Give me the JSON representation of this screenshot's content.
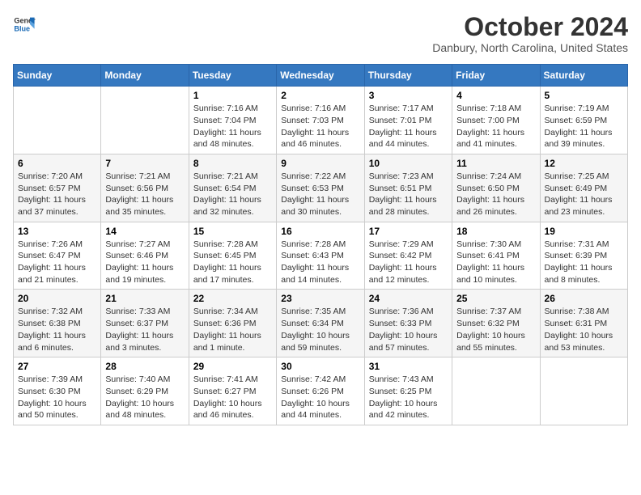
{
  "header": {
    "logo": {
      "text_general": "General",
      "text_blue": "Blue"
    },
    "title": "October 2024",
    "subtitle": "Danbury, North Carolina, United States"
  },
  "calendar": {
    "weekdays": [
      "Sunday",
      "Monday",
      "Tuesday",
      "Wednesday",
      "Thursday",
      "Friday",
      "Saturday"
    ],
    "weeks": [
      [
        {
          "day": "",
          "info": ""
        },
        {
          "day": "",
          "info": ""
        },
        {
          "day": "1",
          "info": "Sunrise: 7:16 AM\nSunset: 7:04 PM\nDaylight: 11 hours and 48 minutes."
        },
        {
          "day": "2",
          "info": "Sunrise: 7:16 AM\nSunset: 7:03 PM\nDaylight: 11 hours and 46 minutes."
        },
        {
          "day": "3",
          "info": "Sunrise: 7:17 AM\nSunset: 7:01 PM\nDaylight: 11 hours and 44 minutes."
        },
        {
          "day": "4",
          "info": "Sunrise: 7:18 AM\nSunset: 7:00 PM\nDaylight: 11 hours and 41 minutes."
        },
        {
          "day": "5",
          "info": "Sunrise: 7:19 AM\nSunset: 6:59 PM\nDaylight: 11 hours and 39 minutes."
        }
      ],
      [
        {
          "day": "6",
          "info": "Sunrise: 7:20 AM\nSunset: 6:57 PM\nDaylight: 11 hours and 37 minutes."
        },
        {
          "day": "7",
          "info": "Sunrise: 7:21 AM\nSunset: 6:56 PM\nDaylight: 11 hours and 35 minutes."
        },
        {
          "day": "8",
          "info": "Sunrise: 7:21 AM\nSunset: 6:54 PM\nDaylight: 11 hours and 32 minutes."
        },
        {
          "day": "9",
          "info": "Sunrise: 7:22 AM\nSunset: 6:53 PM\nDaylight: 11 hours and 30 minutes."
        },
        {
          "day": "10",
          "info": "Sunrise: 7:23 AM\nSunset: 6:51 PM\nDaylight: 11 hours and 28 minutes."
        },
        {
          "day": "11",
          "info": "Sunrise: 7:24 AM\nSunset: 6:50 PM\nDaylight: 11 hours and 26 minutes."
        },
        {
          "day": "12",
          "info": "Sunrise: 7:25 AM\nSunset: 6:49 PM\nDaylight: 11 hours and 23 minutes."
        }
      ],
      [
        {
          "day": "13",
          "info": "Sunrise: 7:26 AM\nSunset: 6:47 PM\nDaylight: 11 hours and 21 minutes."
        },
        {
          "day": "14",
          "info": "Sunrise: 7:27 AM\nSunset: 6:46 PM\nDaylight: 11 hours and 19 minutes."
        },
        {
          "day": "15",
          "info": "Sunrise: 7:28 AM\nSunset: 6:45 PM\nDaylight: 11 hours and 17 minutes."
        },
        {
          "day": "16",
          "info": "Sunrise: 7:28 AM\nSunset: 6:43 PM\nDaylight: 11 hours and 14 minutes."
        },
        {
          "day": "17",
          "info": "Sunrise: 7:29 AM\nSunset: 6:42 PM\nDaylight: 11 hours and 12 minutes."
        },
        {
          "day": "18",
          "info": "Sunrise: 7:30 AM\nSunset: 6:41 PM\nDaylight: 11 hours and 10 minutes."
        },
        {
          "day": "19",
          "info": "Sunrise: 7:31 AM\nSunset: 6:39 PM\nDaylight: 11 hours and 8 minutes."
        }
      ],
      [
        {
          "day": "20",
          "info": "Sunrise: 7:32 AM\nSunset: 6:38 PM\nDaylight: 11 hours and 6 minutes."
        },
        {
          "day": "21",
          "info": "Sunrise: 7:33 AM\nSunset: 6:37 PM\nDaylight: 11 hours and 3 minutes."
        },
        {
          "day": "22",
          "info": "Sunrise: 7:34 AM\nSunset: 6:36 PM\nDaylight: 11 hours and 1 minute."
        },
        {
          "day": "23",
          "info": "Sunrise: 7:35 AM\nSunset: 6:34 PM\nDaylight: 10 hours and 59 minutes."
        },
        {
          "day": "24",
          "info": "Sunrise: 7:36 AM\nSunset: 6:33 PM\nDaylight: 10 hours and 57 minutes."
        },
        {
          "day": "25",
          "info": "Sunrise: 7:37 AM\nSunset: 6:32 PM\nDaylight: 10 hours and 55 minutes."
        },
        {
          "day": "26",
          "info": "Sunrise: 7:38 AM\nSunset: 6:31 PM\nDaylight: 10 hours and 53 minutes."
        }
      ],
      [
        {
          "day": "27",
          "info": "Sunrise: 7:39 AM\nSunset: 6:30 PM\nDaylight: 10 hours and 50 minutes."
        },
        {
          "day": "28",
          "info": "Sunrise: 7:40 AM\nSunset: 6:29 PM\nDaylight: 10 hours and 48 minutes."
        },
        {
          "day": "29",
          "info": "Sunrise: 7:41 AM\nSunset: 6:27 PM\nDaylight: 10 hours and 46 minutes."
        },
        {
          "day": "30",
          "info": "Sunrise: 7:42 AM\nSunset: 6:26 PM\nDaylight: 10 hours and 44 minutes."
        },
        {
          "day": "31",
          "info": "Sunrise: 7:43 AM\nSunset: 6:25 PM\nDaylight: 10 hours and 42 minutes."
        },
        {
          "day": "",
          "info": ""
        },
        {
          "day": "",
          "info": ""
        }
      ]
    ]
  }
}
